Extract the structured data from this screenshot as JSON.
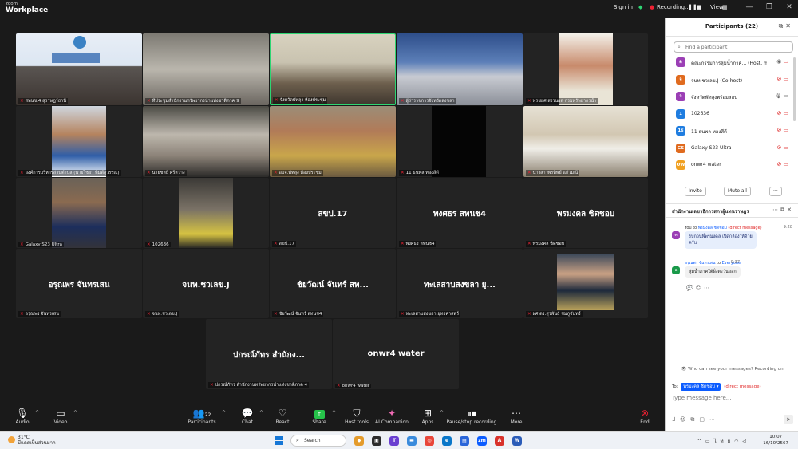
{
  "app": {
    "brand_line1": "zoom",
    "brand_line2": "Workplace"
  },
  "topbar": {
    "signin": "Sign in",
    "recording": "Recording...",
    "view": "View"
  },
  "tiles": [
    {
      "name": "สทนช.4 สุราษฎร์ธานี",
      "muted": true
    },
    {
      "name": "ที่ประชุมสำนักงานทรัพยากรน้ำแห่งชาติภาค 9",
      "muted": true
    },
    {
      "name": "จังหวัดพัทลุง ห้องประชุม",
      "muted": true,
      "active": true
    },
    {
      "name": "ผู้ว่าราชการจังหวัดสงขลา",
      "muted": true
    },
    {
      "name": "พรชยศ สงวนผล กรมทรัพยากรน้ำ",
      "muted": true
    },
    {
      "name": "องค์การบริหารส่วนตำบล (นายไชยา พิมพ์สุวรรณ)",
      "muted": true
    },
    {
      "name": "นายชลธี ศรีสว่าง",
      "muted": true
    },
    {
      "name": "อบจ.พัทลุง ห้องประชุม",
      "muted": true
    },
    {
      "name": "11 ธนพล ทองสีดี",
      "muted": true
    },
    {
      "name": "นางสาวพรทิพย์ แก้วมณี",
      "muted": true
    },
    {
      "name": "Galaxy S23 Ultra",
      "muted": true
    },
    {
      "name": "102636",
      "muted": true
    },
    {
      "name": "สขป.17",
      "muted": true,
      "center": "สขป.17"
    },
    {
      "name": "พงศธร สทนช4",
      "muted": true,
      "center": "พงศธร สทนช4"
    },
    {
      "name": "พรมงคล ชิดชอบ",
      "muted": true,
      "center": "พรมงคล ชิดชอบ"
    },
    {
      "name": "อรุณพร จันทรเสน",
      "muted": true,
      "center": "อรุณพร จันทรเสน"
    },
    {
      "name": "จนท.ชวเลข.J",
      "muted": true,
      "center": "จนท.ชวเลข.J"
    },
    {
      "name": "ชัยวัฒน์ จันทร์ สทนช4",
      "muted": true,
      "center": "ชัยวัฒน์ จันทร์ สท..."
    },
    {
      "name": "ทะเลสาบสงขลา ยุทธศาสตร์",
      "muted": true,
      "center": "ทะเลสาบสงขลา ยุ..."
    },
    {
      "name": "ผศ.ดร.สุรพันธ์ ชมภูจันทร์",
      "muted": true
    },
    {
      "name": "ปกรณ์ภัทร สำนักงานทรัพยากรน้ำแห่งชาติภาค 4",
      "muted": true,
      "center": "ปกรณ์ภัทร สำนักง..."
    },
    {
      "name": "onwr4 water",
      "muted": true,
      "center": "onwr4 water"
    }
  ],
  "toolbar": {
    "audio": "Audio",
    "video": "Video",
    "participants": "Participants",
    "participants_count": "22",
    "chat": "Chat",
    "react": "React",
    "share": "Share",
    "host_tools": "Host tools",
    "ai_companion": "AI Companion",
    "apps": "Apps",
    "record": "Pause/stop recording",
    "more": "More",
    "end": "End"
  },
  "participants_panel": {
    "title": "Participants (22)",
    "search_placeholder": "Find a participant",
    "list": [
      {
        "initials": "ค",
        "color": "#9b3fb5",
        "name": "คณะกรรมการลุ่มน้ำภาค... (Host, me)",
        "icons": "mic-video"
      },
      {
        "initials": "จ",
        "color": "#e06b1f",
        "name": "จนท.ชวเลข.J (Co-host)",
        "icons": "muted"
      },
      {
        "initials": "จ",
        "color": "#9b3fb5",
        "name": "จังหวัดพัทลุงพร้อมสอน",
        "icons": "mic"
      },
      {
        "initials": "1",
        "color": "#1f7de0",
        "name": "102636",
        "icons": "muted"
      },
      {
        "initials": "1ธ",
        "color": "#1f7de0",
        "name": "11 ธนพล ทองสีดี",
        "icons": "muted"
      },
      {
        "initials": "GS",
        "color": "#e06b1f",
        "name": "Galaxy S23 Ultra",
        "icons": "muted"
      },
      {
        "initials": "OW",
        "color": "#f0a020",
        "name": "onwr4 water",
        "icons": "muted"
      }
    ],
    "invite": "Invite",
    "mute_all": "Mute all",
    "more": "···"
  },
  "chat_panel": {
    "title": "สำนักงานเลขาธิการสภาผู้แทนราษฎร",
    "messages": [
      {
        "initials": "ค",
        "color": "#9b3fb5",
        "from": "You",
        "to_word": "to",
        "to": "พรมงคล ชิดชอบ",
        "note": "(direct message)",
        "time": "9:28",
        "line1": "รบกวนพี่พรมงคล เปิดกล้องให้ด้วย",
        "line2": "ครับ"
      },
      {
        "initials": "อ",
        "color": "#1a9a4a",
        "from": "อรุณพร จันทรเสน",
        "to_word": "to",
        "to": "Everyone",
        "time": "9:37",
        "line1": "ลุ่มน้ำภาคใต้ฝั่งตะวันออก"
      }
    ],
    "notice": "Who can see your messages? Recording on",
    "to_label": "To:",
    "to_chip": "พรมงคล ชิดชอบ",
    "to_note": "(direct message)",
    "input_placeholder": "Type message here..."
  },
  "taskbar": {
    "temp": "31°C",
    "weather": "มีแดดเป็นส่วนมาก",
    "search": "Search",
    "lang": "ไทย",
    "time": "10:07",
    "date": "16/10/2567"
  }
}
